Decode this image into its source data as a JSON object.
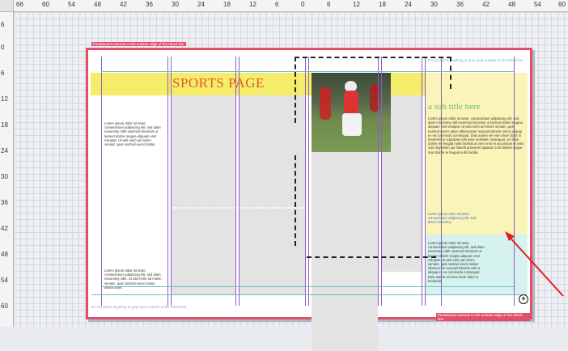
{
  "ruler": {
    "top_ticks": [
      "66",
      "60",
      "54",
      "48",
      "42",
      "36",
      "30",
      "24",
      "18",
      "12",
      "6",
      "0",
      "6",
      "12",
      "18",
      "24",
      "30",
      "36",
      "42",
      "48",
      "54",
      "60"
    ],
    "left_ticks": [
      "6",
      "0",
      "6",
      "12",
      "18",
      "24",
      "30",
      "36",
      "42",
      "48",
      "54",
      "60"
    ]
  },
  "page": {
    "slug_top_left": "Pasteboard extends to the outside edge of the bleed line",
    "slug_top_right": "Do not place anything in gray area outside of the bleed line",
    "slug_bottom_left": "Do not place anything in gray area outside of the bleed line",
    "slug_bottom_right": "Pasteboard extends to the outside edge of the bleed line",
    "title": "SPORTS PAGE",
    "subtitle": "a sub title here",
    "col1_top_text": "Lorem ipsum dolor sit amet, consectetuer adipiscing elit, sed diam nonummy nibh euismod tincidunt ut laoreet dolore magna aliquam erat volutpat. Ut wisi enim ad minim veniam, quis nostrud exerci tation.",
    "col1_bottom_text": "Lorem ipsum dolor sit amet, consectetuer adipiscing elit, sed diam nonummy nibh. Ut wisi enim ad minim veniam, quis nostrud exerci tation ullamcorper.",
    "side_text": "Lorem ipsum dolor sit amet, consectetuer adipiscing elit, sed diam nonummy nibh euismod tincidunt ut laoreet dolore magna aliquam erat volutpat. Ut wisi enim ad minim veniam, quis nostrud exerci tation ullamcorper suscipit lobortis nisl ut aliquip ex ea commodo consequat. Duis autem vel eum iriure dolor in hendrerit in vulputate velit esse molestie consequat, vel illum dolore eu feugiat nulla facilisis at vero eros et accumsan et iusto odio dignissim qui blandit praesent luptatum zzril delenit augue duis dolore te feugait nulla facilisi.",
    "side_caption": "Lorem ipsum dolor sit amet, consectetuer adipiscing elit, sed diam nonummy.",
    "cyan_text": "Lorem ipsum dolor sit amet, consectetuer adipiscing elit, sed diam nonummy nibh euismod tincidunt ut laoreet dolore magna aliquam erat volutpat. Ut wisi enim ad minim veniam, quis nostrud exerci tation ullamcorper suscipit lobortis nisl ut aliquip ex ea commodo consequat. Duis autem vel eum iriure dolor in hendrerit."
  },
  "colors": {
    "bleed_border": "#e0506a",
    "banner": "#f5ec6a",
    "title": "#e05a2a",
    "subtitle": "#6bbf6b",
    "guides": "#8b5fbf",
    "arrow": "#e02020"
  },
  "icons": {
    "zoom": "zoom-in-icon"
  }
}
